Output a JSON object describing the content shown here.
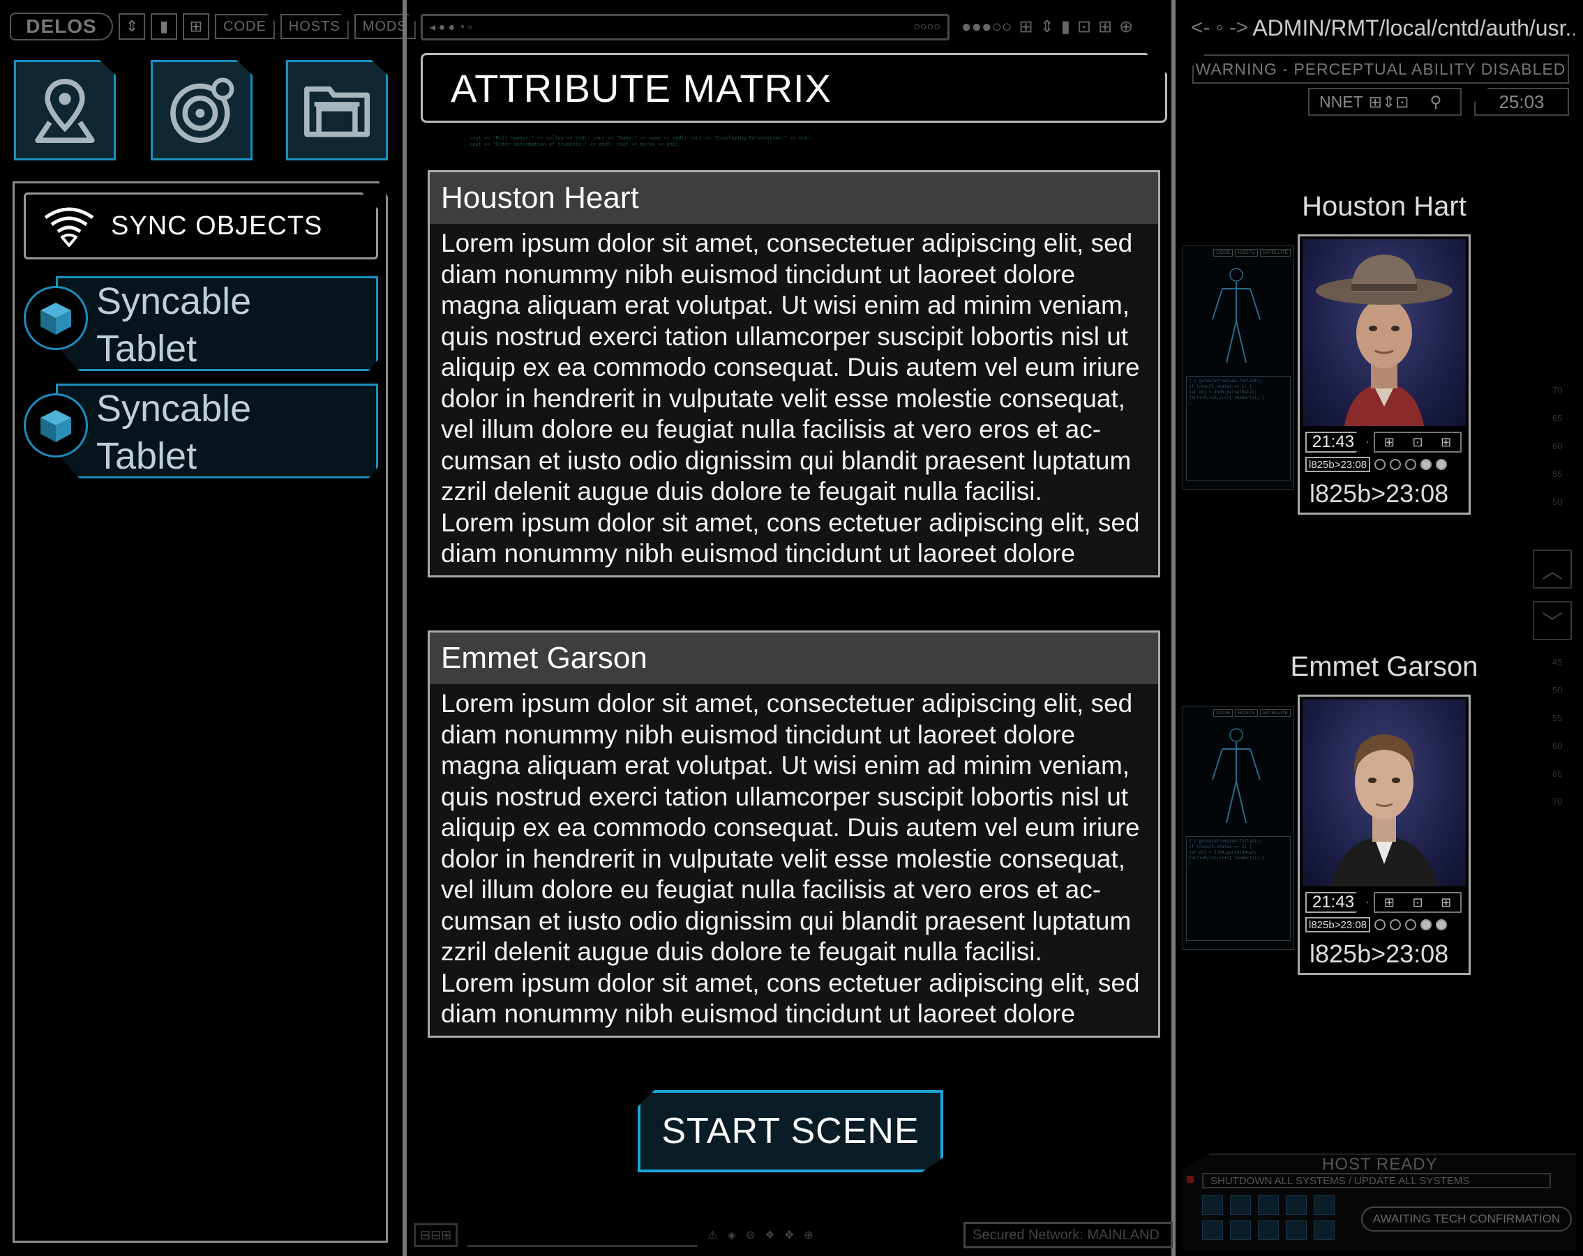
{
  "left": {
    "toolbar": {
      "logo": "DELOS",
      "tabs": [
        "CODE",
        "HOSTS",
        "MODS"
      ],
      "icons": [
        "sort-icon",
        "tablet-icon",
        "grid-move-icon"
      ]
    },
    "tiles": [
      {
        "icon": "map-pin-icon"
      },
      {
        "icon": "orbit-target-icon"
      },
      {
        "icon": "folder-drive-icon"
      }
    ],
    "sync": {
      "header": "SYNC OBJECTS",
      "items": [
        {
          "label": "Syncable Tablet"
        },
        {
          "label": "Syncable Tablet"
        }
      ]
    }
  },
  "middle": {
    "title": "ATTRIBUTE MATRIX",
    "cards": [
      {
        "name": "Houston Heart",
        "body": "Lorem ipsum dolor sit amet, consectetuer adipiscing elit, sed diam nonummy nibh euismod tincidunt ut laoreet dolore magna aliquam erat volutpat. Ut wisi enim ad minim veniam, quis nostrud exerci tation ullamcorper suscipit lobortis nisl ut aliquip ex ea commodo consequat. Duis autem vel eum iriure dolor in hendrerit in vulputate velit esse molestie consequat, vel illum dolore eu feugiat nulla facilisis at vero eros et ac-cumsan et iusto odio dignissim qui blandit praesent luptatum zzril delenit augue duis dolore te feugait nulla facilisi.",
        "body2": "Lorem ipsum dolor sit amet, cons ectetuer adipiscing elit, sed diam nonummy nibh euismod tincidunt ut laoreet dolore"
      },
      {
        "name": "Emmet Garson",
        "body": "Lorem ipsum dolor sit amet, consectetuer adipiscing elit, sed diam nonummy nibh euismod tincidunt ut laoreet dolore magna aliquam erat volutpat. Ut wisi enim ad minim veniam, quis nostrud exerci tation ullamcorper suscipit lobortis nisl ut aliquip ex ea commodo consequat. Duis autem vel eum iriure dolor in hendrerit in vulputate velit esse molestie consequat, vel illum dolore eu feugiat nulla facilisis at vero eros et ac-cumsan et iusto odio dignissim qui blandit praesent luptatum zzril delenit augue duis dolore te feugait nulla facilisi.",
        "body2": "Lorem ipsum dolor sit amet, cons ectetuer adipiscing elit, sed diam nonummy nibh euismod tincidunt ut laoreet dolore"
      }
    ],
    "start_button": "START SCENE",
    "status_bar": {
      "network": "Secured Network: MAINLAND"
    }
  },
  "right": {
    "breadcrumb": {
      "arrows": "<- ◦ ->",
      "path": "ADMIN/RMT/local/cntd/auth/usr..."
    },
    "warning": "WARNING - PERCEPTUAL ABILITY DISABLED",
    "nnet": "NNET",
    "clock": "25:03",
    "hosts": [
      {
        "name": "Houston Hart",
        "time": "21:43",
        "code_small": "l825b>23:08",
        "code_big": "l825b>23:08"
      },
      {
        "name": "Emmet Garson",
        "time": "21:43",
        "code_small": "l825b>23:08",
        "code_big": "l825b>23:08"
      }
    ],
    "scale_top": [
      "70",
      "65",
      "60",
      "55",
      "50"
    ],
    "scale_bottom": [
      "45",
      "50",
      "55",
      "60",
      "65",
      "70"
    ],
    "dock": {
      "ready": "HOST READY",
      "shutdown": "SHUTDOWN ALL SYSTEMS / UPDATE ALL SYSTEMS",
      "awaiting": "AWAITING TECH CONFIRMATION"
    },
    "mini_tabs": [
      "CODE",
      "HOSTS",
      "SATELLITE"
    ]
  },
  "colors": {
    "accent": "#1b8fbf",
    "accent_bright": "#1aa6d9",
    "panel_bg": "#0e2733",
    "card_header": "#3e3e3e"
  }
}
